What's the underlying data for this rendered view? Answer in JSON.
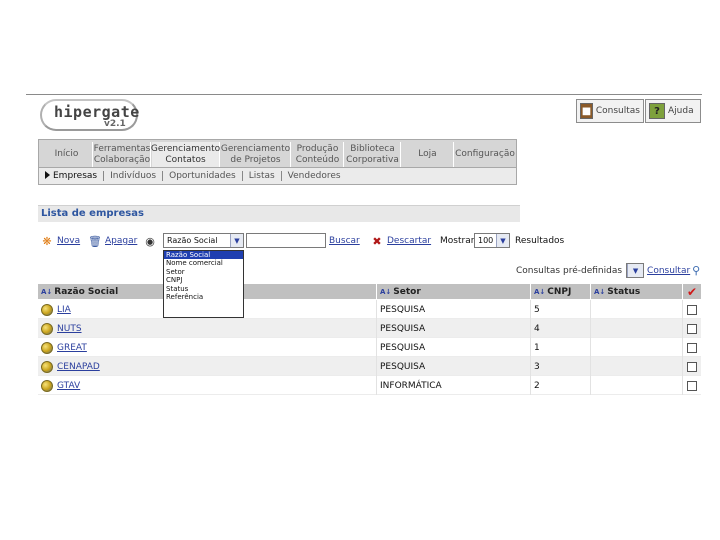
{
  "app": {
    "logo_text": "hipergate",
    "logo_version": "v2.1"
  },
  "top_buttons": {
    "consultas": "Consultas",
    "ajuda": "Ajuda"
  },
  "nav": {
    "items": [
      {
        "label": "Início"
      },
      {
        "label": "Ferramentas Colaboração"
      },
      {
        "label": "Gerenciamento Contatos"
      },
      {
        "label": "Gerenciamento de Projetos"
      },
      {
        "label": "Produção Conteúdo"
      },
      {
        "label": "Biblioteca Corporativa"
      },
      {
        "label": "Loja"
      },
      {
        "label": "Configuração"
      }
    ],
    "sub_items": [
      {
        "label": "Empresas"
      },
      {
        "label": "Indivíduos"
      },
      {
        "label": "Oportunidades"
      },
      {
        "label": "Listas"
      },
      {
        "label": "Vendedores"
      }
    ]
  },
  "page": {
    "title": "Lista de empresas"
  },
  "toolbar": {
    "new_label": "Nova",
    "delete_label": "Apagar",
    "search_field_selected": "Razão Social",
    "search_value": "",
    "search_button": "Buscar",
    "discard_label": "Descartar",
    "show_label": "Mostrar",
    "show_count": "100",
    "results_label": "Resultados"
  },
  "search_field_options": [
    "Razão Social",
    "Nome comercial",
    "Setor",
    "CNPJ",
    "Status",
    "Referência"
  ],
  "predefined": {
    "label": "Consultas pré-definidas",
    "button": "Consultar"
  },
  "table": {
    "headers": [
      "Razão Social",
      "Setor",
      "CNPJ",
      "Status"
    ],
    "rows": [
      {
        "name": "LIA",
        "sector": "PESQUISA",
        "cnpj": "5",
        "status": ""
      },
      {
        "name": "NUTS",
        "sector": "PESQUISA",
        "cnpj": "4",
        "status": ""
      },
      {
        "name": "GREAT",
        "sector": "PESQUISA",
        "cnpj": "1",
        "status": ""
      },
      {
        "name": "CENAPAD",
        "sector": "PESQUISA",
        "cnpj": "3",
        "status": ""
      },
      {
        "name": "GTAV",
        "sector": "INFORMÁTICA",
        "cnpj": "2",
        "status": ""
      }
    ]
  },
  "colors": {
    "link": "#2b3f9e",
    "title": "#2e56a0",
    "header_bg": "#c0c0c0",
    "nav_bg": "#d6d6d6",
    "dropdown_selected": "#1f3fb0"
  }
}
